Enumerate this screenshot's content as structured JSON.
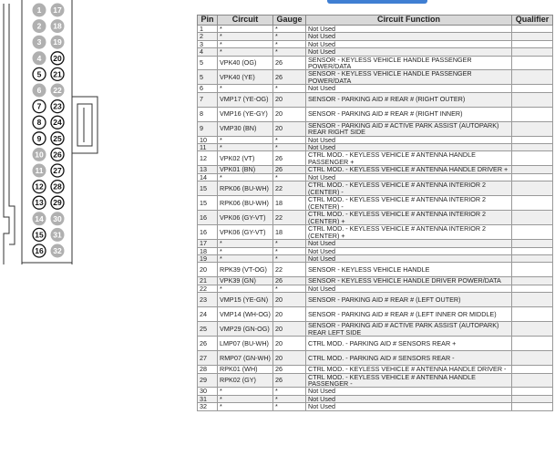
{
  "header": {
    "pin": "Pin",
    "circuit": "Circuit",
    "gauge": "Gauge",
    "function": "Circuit Function",
    "qualifier": "Qualifier"
  },
  "colors": {
    "accent": "#3f7fd3",
    "unused_pin_fill": "#b0b0b0",
    "header_bg": "#d9d9d9",
    "row_shade": "#efefef"
  },
  "connector": {
    "left_column": [
      {
        "label": "1",
        "used": false
      },
      {
        "label": "2",
        "used": false
      },
      {
        "label": "3",
        "used": false
      },
      {
        "label": "4",
        "used": false
      },
      {
        "label": "5",
        "used": true
      },
      {
        "label": "6",
        "used": false
      },
      {
        "label": "7",
        "used": true
      },
      {
        "label": "8",
        "used": true
      },
      {
        "label": "9",
        "used": true
      },
      {
        "label": "10",
        "used": false
      },
      {
        "label": "11",
        "used": false
      },
      {
        "label": "12",
        "used": true
      },
      {
        "label": "13",
        "used": true
      },
      {
        "label": "14",
        "used": false
      },
      {
        "label": "15",
        "used": true
      },
      {
        "label": "16",
        "used": true
      }
    ],
    "right_column": [
      {
        "label": "17",
        "used": false
      },
      {
        "label": "18",
        "used": false
      },
      {
        "label": "19",
        "used": false
      },
      {
        "label": "20",
        "used": true
      },
      {
        "label": "21",
        "used": true
      },
      {
        "label": "22",
        "used": false
      },
      {
        "label": "23",
        "used": true
      },
      {
        "label": "24",
        "used": true
      },
      {
        "label": "25",
        "used": true
      },
      {
        "label": "26",
        "used": true
      },
      {
        "label": "27",
        "used": true
      },
      {
        "label": "28",
        "used": true
      },
      {
        "label": "29",
        "used": true
      },
      {
        "label": "30",
        "used": false
      },
      {
        "label": "31",
        "used": false
      },
      {
        "label": "32",
        "used": false
      }
    ]
  },
  "rows": [
    {
      "pin": "1",
      "circuit": "*",
      "gauge": "*",
      "function": "Not Used",
      "qualifier": ""
    },
    {
      "pin": "2",
      "circuit": "*",
      "gauge": "*",
      "function": "Not Used",
      "qualifier": ""
    },
    {
      "pin": "3",
      "circuit": "*",
      "gauge": "*",
      "function": "Not Used",
      "qualifier": ""
    },
    {
      "pin": "4",
      "circuit": "*",
      "gauge": "*",
      "function": "Not Used",
      "qualifier": ""
    },
    {
      "pin": "5",
      "circuit": "VPK40 (OG)",
      "gauge": "26",
      "function": "SENSOR - KEYLESS VEHICLE HANDLE PASSENGER POWER/DATA",
      "qualifier": ""
    },
    {
      "pin": "5",
      "circuit": "VPK40 (YE)",
      "gauge": "26",
      "function": "SENSOR - KEYLESS VEHICLE HANDLE PASSENGER POWER/DATA",
      "qualifier": ""
    },
    {
      "pin": "6",
      "circuit": "*",
      "gauge": "*",
      "function": "Not Used",
      "qualifier": ""
    },
    {
      "pin": "7",
      "circuit": "VMP17 (YE-OG)",
      "gauge": "20",
      "function": "SENSOR - PARKING AID # REAR # (RIGHT OUTER)",
      "qualifier": ""
    },
    {
      "pin": "8",
      "circuit": "VMP16 (YE-GY)",
      "gauge": "20",
      "function": "SENSOR - PARKING AID # REAR # (RIGHT INNER)",
      "qualifier": ""
    },
    {
      "pin": "9",
      "circuit": "VMP30 (BN)",
      "gauge": "20",
      "function": "SENSOR - PARKING AID # ACTIVE PARK ASSIST (AUTOPARK) REAR RIGHT SIDE",
      "qualifier": ""
    },
    {
      "pin": "10",
      "circuit": "*",
      "gauge": "*",
      "function": "Not Used",
      "qualifier": ""
    },
    {
      "pin": "11",
      "circuit": "*",
      "gauge": "*",
      "function": "Not Used",
      "qualifier": ""
    },
    {
      "pin": "12",
      "circuit": "VPK02 (VT)",
      "gauge": "26",
      "function": "CTRL MOD. - KEYLESS VEHICLE # ANTENNA HANDLE PASSENGER +",
      "qualifier": ""
    },
    {
      "pin": "13",
      "circuit": "VPK01 (BN)",
      "gauge": "26",
      "function": "CTRL MOD. - KEYLESS VEHICLE # ANTENNA HANDLE DRIVER +",
      "qualifier": ""
    },
    {
      "pin": "14",
      "circuit": "*",
      "gauge": "*",
      "function": "Not Used",
      "qualifier": ""
    },
    {
      "pin": "15",
      "circuit": "RPK06 (BU-WH)",
      "gauge": "22",
      "function": "CTRL MOD. - KEYLESS VEHICLE # ANTENNA INTERIOR 2 (CENTER) -",
      "qualifier": ""
    },
    {
      "pin": "15",
      "circuit": "RPK06 (BU-WH)",
      "gauge": "18",
      "function": "CTRL MOD. - KEYLESS VEHICLE # ANTENNA INTERIOR 2 (CENTER) -",
      "qualifier": ""
    },
    {
      "pin": "16",
      "circuit": "VPK06 (GY-VT)",
      "gauge": "22",
      "function": "CTRL MOD. - KEYLESS VEHICLE # ANTENNA INTERIOR 2 (CENTER) +",
      "qualifier": ""
    },
    {
      "pin": "16",
      "circuit": "VPK06 (GY-VT)",
      "gauge": "18",
      "function": "CTRL MOD. - KEYLESS VEHICLE # ANTENNA INTERIOR 2 (CENTER) +",
      "qualifier": ""
    },
    {
      "pin": "17",
      "circuit": "*",
      "gauge": "*",
      "function": "Not Used",
      "qualifier": ""
    },
    {
      "pin": "18",
      "circuit": "*",
      "gauge": "*",
      "function": "Not Used",
      "qualifier": ""
    },
    {
      "pin": "19",
      "circuit": "*",
      "gauge": "*",
      "function": "Not Used",
      "qualifier": ""
    },
    {
      "pin": "20",
      "circuit": "RPK39 (VT-OG)",
      "gauge": "22",
      "function": "SENSOR - KEYLESS VEHICLE HANDLE",
      "qualifier": ""
    },
    {
      "pin": "21",
      "circuit": "VPK39 (GN)",
      "gauge": "26",
      "function": "SENSOR - KEYLESS VEHICLE HANDLE DRIVER POWER/DATA",
      "qualifier": ""
    },
    {
      "pin": "22",
      "circuit": "*",
      "gauge": "*",
      "function": "Not Used",
      "qualifier": ""
    },
    {
      "pin": "23",
      "circuit": "VMP15 (YE-GN)",
      "gauge": "20",
      "function": "SENSOR - PARKING AID # REAR # (LEFT OUTER)",
      "qualifier": ""
    },
    {
      "pin": "24",
      "circuit": "VMP14 (WH-OG)",
      "gauge": "20",
      "function": "SENSOR - PARKING AID # REAR # (LEFT INNER OR MIDDLE)",
      "qualifier": ""
    },
    {
      "pin": "25",
      "circuit": "VMP29 (GN-OG)",
      "gauge": "20",
      "function": "SENSOR - PARKING AID # ACTIVE PARK ASSIST (AUTOPARK) REAR LEFT SIDE",
      "qualifier": ""
    },
    {
      "pin": "26",
      "circuit": "LMP07 (BU-WH)",
      "gauge": "20",
      "function": "CTRL MOD. - PARKING AID # SENSORS REAR +",
      "qualifier": ""
    },
    {
      "pin": "27",
      "circuit": "RMP07 (GN-WH)",
      "gauge": "20",
      "function": "CTRL MOD. - PARKING AID # SENSORS REAR -",
      "qualifier": ""
    },
    {
      "pin": "28",
      "circuit": "RPK01 (WH)",
      "gauge": "26",
      "function": "CTRL MOD. - KEYLESS VEHICLE # ANTENNA HANDLE DRIVER -",
      "qualifier": ""
    },
    {
      "pin": "29",
      "circuit": "RPK02 (GY)",
      "gauge": "26",
      "function": "CTRL MOD. - KEYLESS VEHICLE # ANTENNA HANDLE PASSENGER -",
      "qualifier": ""
    },
    {
      "pin": "30",
      "circuit": "*",
      "gauge": "*",
      "function": "Not Used",
      "qualifier": ""
    },
    {
      "pin": "31",
      "circuit": "*",
      "gauge": "*",
      "function": "Not Used",
      "qualifier": ""
    },
    {
      "pin": "32",
      "circuit": "*",
      "gauge": "*",
      "function": "Not Used",
      "qualifier": ""
    }
  ]
}
